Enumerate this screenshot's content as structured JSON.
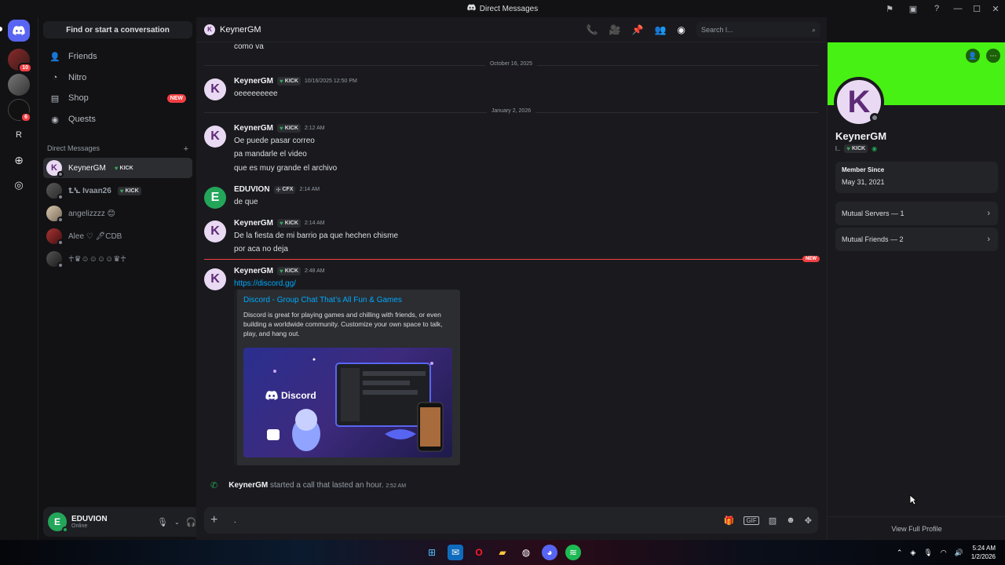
{
  "window": {
    "title": "Direct Messages"
  },
  "sidebar": {
    "search_label": "Find or start a conversation",
    "nav": [
      {
        "label": "Friends",
        "icon": "friends-icon"
      },
      {
        "label": "Nitro",
        "icon": "nitro-icon"
      },
      {
        "label": "Shop",
        "icon": "shop-icon",
        "badge": "NEW"
      },
      {
        "label": "Quests",
        "icon": "quests-icon"
      }
    ],
    "dm_header": "Direct Messages",
    "dms": [
      {
        "name": "KeynerGM",
        "tag": "KICK",
        "initial": "K"
      },
      {
        "name": "ꝈꝆ Ivaan26",
        "tag": "KICK"
      },
      {
        "name": "angelizzzz 😊"
      },
      {
        "name": "Alee ♡ 🖋CDB"
      },
      {
        "name": "☥♛☺☺☺☺♛☥"
      }
    ]
  },
  "rail": {
    "badges": [
      "10",
      "6"
    ],
    "letter": "R"
  },
  "user": {
    "name": "EDUVION",
    "status": "Online",
    "initial": "E"
  },
  "chat": {
    "header_name": "KeynerGM",
    "search_placeholder": "Search l...",
    "top_line": "como va",
    "dates": [
      "October 16, 2025",
      "January 2, 2026"
    ],
    "messages": [
      {
        "author": "KeynerGM",
        "tag": "KICK",
        "time": "10/16/2025 12:50 PM",
        "lines": [
          "oeeeeeeeee"
        ]
      },
      {
        "author": "KeynerGM",
        "tag": "KICK",
        "time": "2:12 AM",
        "lines": [
          "Oe puede pasar correo",
          "pa mandarle el video",
          "que es muy grande el archivo"
        ]
      },
      {
        "author": "EDUVION",
        "tag": "CFX",
        "time": "2:14 AM",
        "lines": [
          "de que"
        ]
      },
      {
        "author": "KeynerGM",
        "tag": "KICK",
        "time": "2:14 AM",
        "lines": [
          "De la fiesta de mi barrio pa que hechen chisme",
          "por aca no deja"
        ]
      },
      {
        "author": "KeynerGM",
        "tag": "KICK",
        "time": "2:48 AM",
        "lines": [
          "https://discord.gg/"
        ]
      }
    ],
    "new_label": "NEW",
    "embed": {
      "title": "Discord - Group Chat That’s All Fun & Games",
      "description": "Discord is great for playing games and chilling with friends, or even building a worldwide community. Customize your own space to talk, play, and hang out.",
      "image_logo": "Discord"
    },
    "call": {
      "author": "KeynerGM",
      "text": "started a call that lasted an hour.",
      "time": "2:52 AM"
    },
    "composer_value": "."
  },
  "profile": {
    "name": "KeynerGM",
    "sub": "l..",
    "tag": "KICK",
    "member_since_label": "Member Since",
    "member_since": "May 31, 2021",
    "mutual_servers": "Mutual Servers — 1",
    "mutual_friends": "Mutual Friends — 2",
    "view_full": "View Full Profile",
    "banner_color": "#47f113"
  },
  "taskbar": {
    "time": "5:24 AM",
    "date": "1/2/2026"
  },
  "colors": {
    "accent": "#5865f2",
    "link": "#00a8fc",
    "danger": "#f23f43",
    "online": "#23a55a"
  }
}
